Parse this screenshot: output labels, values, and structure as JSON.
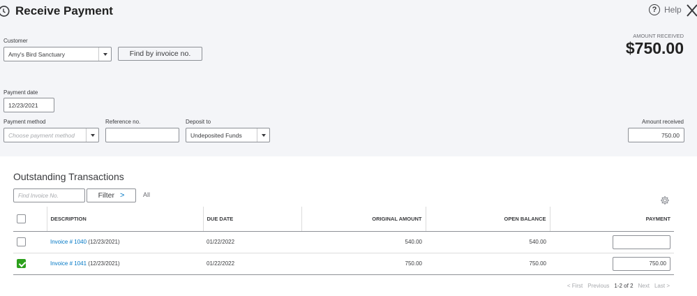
{
  "header": {
    "title": "Receive Payment",
    "history_icon": "history-icon",
    "help_label": "Help",
    "help_icon": "question-circle-icon",
    "close_icon": "close-icon"
  },
  "customer": {
    "label": "Customer",
    "value": "Amy's Bird Sanctuary",
    "find_button": "Find by invoice no."
  },
  "amount_summary": {
    "label": "AMOUNT RECEIVED",
    "value": "$750.00"
  },
  "payment_date": {
    "label": "Payment date",
    "value": "12/23/2021"
  },
  "payment_method": {
    "label": "Payment method",
    "placeholder": "Choose payment method"
  },
  "reference": {
    "label": "Reference no.",
    "value": ""
  },
  "deposit_to": {
    "label": "Deposit to",
    "value": "Undeposited Funds"
  },
  "amount_received": {
    "label": "Amount received",
    "value": "750.00"
  },
  "outstanding": {
    "title": "Outstanding Transactions",
    "search_placeholder": "Find Invoice No.",
    "filter_label": "Filter",
    "filter_chevron": ">",
    "all_label": "All",
    "settings_icon": "gear-icon",
    "columns": [
      "DESCRIPTION",
      "DUE DATE",
      "ORIGINAL AMOUNT",
      "OPEN BALANCE",
      "PAYMENT"
    ],
    "rows": [
      {
        "checked": false,
        "invoice": "Invoice # 1040",
        "date": "(12/23/2021)",
        "due": "01/22/2022",
        "original": "540.00",
        "balance": "540.00",
        "payment": ""
      },
      {
        "checked": true,
        "invoice": "Invoice # 1041",
        "date": "(12/23/2021)",
        "due": "01/22/2022",
        "original": "750.00",
        "balance": "750.00",
        "payment": "750.00"
      }
    ]
  },
  "pagination": {
    "first": "< First",
    "previous": "Previous",
    "current": "1-2 of 2",
    "next": "Next",
    "last": "Last >"
  },
  "colors": {
    "link": "#0077c5",
    "checkbox_checked": "#2ca01c",
    "header_bg": "#f4f5f8"
  }
}
